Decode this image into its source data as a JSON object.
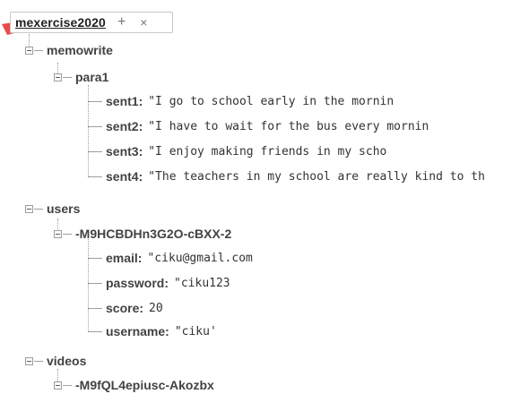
{
  "root": {
    "name": "mexercise2020",
    "add_icon": "+",
    "close_icon": "×"
  },
  "tree": {
    "memowrite": {
      "key": "memowrite",
      "para1": {
        "key": "para1",
        "sentences": [
          {
            "key": "sent1:",
            "value": "\"I go to school early in the mornin"
          },
          {
            "key": "sent2:",
            "value": "\"I have to wait for the bus every mornin"
          },
          {
            "key": "sent3:",
            "value": "\"I enjoy making friends in my scho"
          },
          {
            "key": "sent4:",
            "value": "\"The teachers in my school are really kind to th"
          }
        ]
      }
    },
    "users": {
      "key": "users",
      "user": {
        "key": "-M9HCBDHn3G2O-cBXX-2",
        "fields": [
          {
            "key": "email:",
            "value": "\"ciku@gmail.com"
          },
          {
            "key": "password:",
            "value": "\"ciku123"
          },
          {
            "key": "score:",
            "value": "20"
          },
          {
            "key": "username:",
            "value": "\"ciku'"
          }
        ]
      }
    },
    "videos": {
      "key": "videos",
      "video": {
        "key": "-M9fQL4epiusc-Akozbx"
      }
    }
  },
  "colors": {
    "key_text": "#424242",
    "value_text": "#333333",
    "tree_line": "#9e9e9e",
    "accent_mark": "#e53935"
  }
}
